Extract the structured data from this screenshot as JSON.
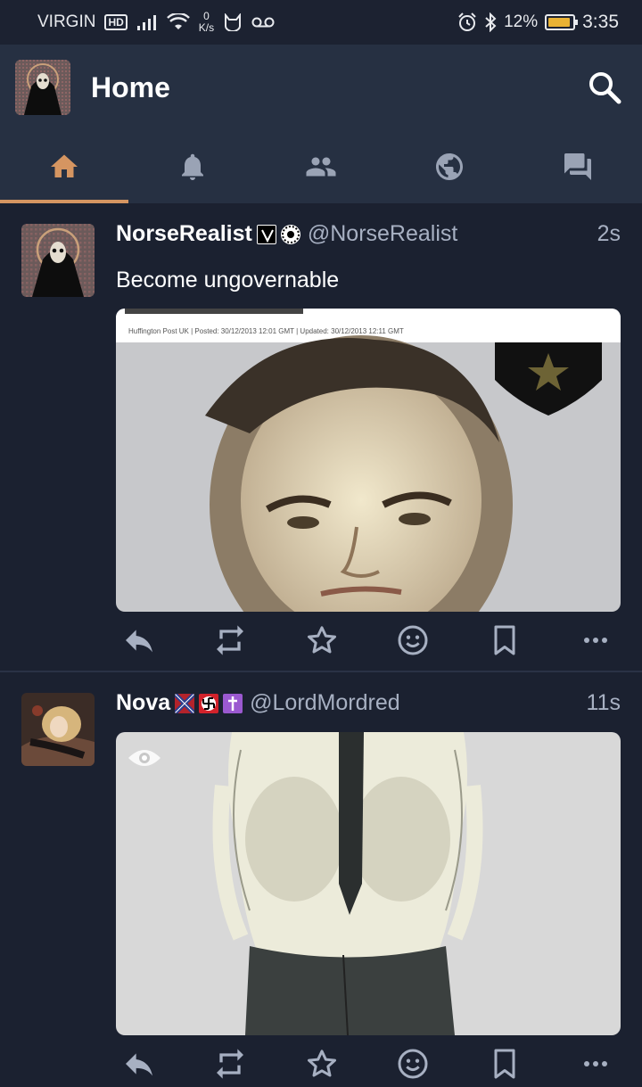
{
  "status_bar": {
    "carrier": "VIRGIN",
    "network_badge": "HD",
    "speed_value": "0",
    "speed_unit": "K/s",
    "battery": "12%",
    "battery_level": 0.12,
    "time": "3:35"
  },
  "header": {
    "title": "Home",
    "search_icon": "search-icon"
  },
  "tabs": [
    {
      "icon": "home-icon",
      "active": true
    },
    {
      "icon": "bell-icon",
      "active": false
    },
    {
      "icon": "people-icon",
      "active": false
    },
    {
      "icon": "globe-icon",
      "active": false
    },
    {
      "icon": "chat-icon",
      "active": false
    }
  ],
  "colors": {
    "background": "#1b2130",
    "header": "#263042",
    "accent": "#d59561",
    "muted_text": "#a7b0c2"
  },
  "posts": [
    {
      "display_name": "NorseRealist",
      "handle": "@NorseRealist",
      "time": "2s",
      "text": "Become ungovernable",
      "media_caption": "Huffington Post UK | Posted: 30/12/2013 12:01 GMT | Updated: 30/12/2013 12:11 GMT",
      "media_kind": "mugshot photo"
    },
    {
      "display_name": "Nova",
      "handle": "@LordMordred",
      "time": "11s",
      "text": "",
      "media_kind": "anime illustration"
    }
  ],
  "actions": [
    "reply-icon",
    "boost-icon",
    "favourite-icon",
    "emoji-reaction-icon",
    "bookmark-icon",
    "more-icon"
  ]
}
